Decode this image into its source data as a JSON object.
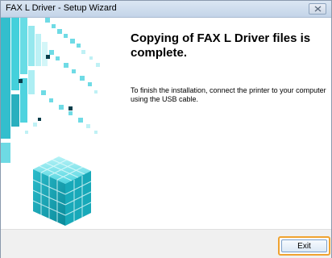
{
  "window": {
    "title": "FAX L Driver - Setup Wizard",
    "close_icon": "close-icon"
  },
  "main": {
    "heading": "Copying of FAX L Driver files is complete.",
    "message": "To finish the installation, connect the printer to your computer using the USB cable."
  },
  "footer": {
    "exit_label": "Exit",
    "exit_highlight_color": "#f0a330"
  },
  "colors": {
    "cube_dark": "#0a8fa0",
    "cube_light": "#7fe3ec",
    "cube_mid": "#2ec3d1"
  },
  "icons": {
    "graphic": "cube-graphic-icon"
  }
}
